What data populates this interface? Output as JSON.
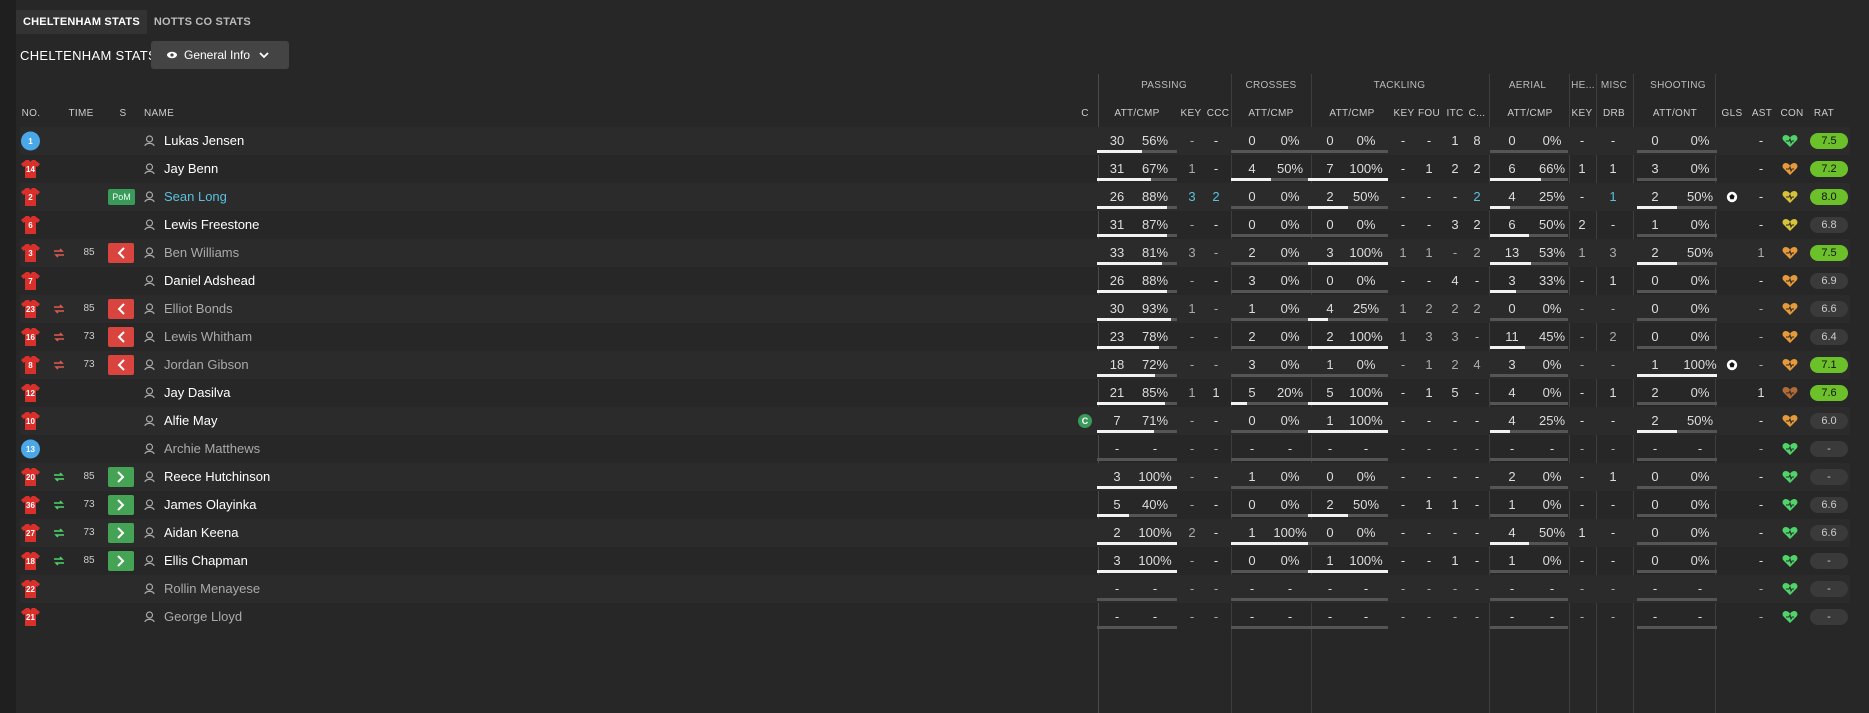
{
  "tabs": [
    {
      "label": "CHELTENHAM STATS",
      "active": true
    },
    {
      "label": "NOTTS CO STATS",
      "active": false
    }
  ],
  "section_title": "CHELTENHAM STATS",
  "view_dropdown": {
    "label": "General Info",
    "icon": "eye-icon"
  },
  "groups": [
    "PASSING",
    "CROSSES",
    "TACKLING",
    "AERIAL",
    "HE...",
    "MISC",
    "SHOOTING"
  ],
  "columns": {
    "no": "NO.",
    "time": "TIME",
    "s": "S",
    "name": "NAME",
    "c": "C",
    "pass_attcmp": "ATT/CMP",
    "pass_key": "KEY",
    "pass_ccc": "CCC",
    "cross_attcmp": "ATT/CMP",
    "tack_attcmp": "ATT/CMP",
    "tack_key": "KEY",
    "tack_fou": "FOU",
    "tack_itc": "ITC",
    "tack_c": "C...",
    "aer_attcmp": "ATT/CMP",
    "he_key": "KEY",
    "misc_drb": "DRB",
    "shoot_attont": "ATT/ONT",
    "gls": "GLS",
    "ast": "AST",
    "con": "CON",
    "rat": "RAT"
  },
  "colors": {
    "home_shirt": "#d9302c",
    "gk_shirt": "#4aa8e8",
    "rating_green": "#6cc02a",
    "highlight": "#5bc0de"
  },
  "players": [
    {
      "no": "1",
      "gk": true,
      "time": "",
      "sub": "",
      "pom": false,
      "name": "Lukas Jensen",
      "style": "",
      "capt": false,
      "pa": "30",
      "pp": "56%",
      "pbar": 56,
      "pk": "-",
      "pc": "-",
      "ca": "0",
      "cp": "0%",
      "cbar": 0,
      "ta": "0",
      "tp": "0%",
      "tbar": 0,
      "tk": "-",
      "tf": "-",
      "ti": "1",
      "tc": "8",
      "aa": "0",
      "ap": "0%",
      "abar": 0,
      "hk": "-",
      "md": "-",
      "sa": "0",
      "sp": "0%",
      "sbar": 0,
      "gls": "",
      "ast": "-",
      "rat": "7.5",
      "ratc": "green",
      "heart": "green"
    },
    {
      "no": "14",
      "gk": false,
      "time": "",
      "sub": "",
      "pom": false,
      "name": "Jay Benn",
      "style": "",
      "capt": false,
      "pa": "31",
      "pp": "67%",
      "pbar": 67,
      "pk": "1",
      "pc": "-",
      "ca": "4",
      "cp": "50%",
      "cbar": 50,
      "ta": "7",
      "tp": "100%",
      "tbar": 100,
      "tk": "-",
      "tf": "1",
      "ti": "2",
      "tc": "2",
      "aa": "6",
      "ap": "66%",
      "abar": 66,
      "hk": "1",
      "md": "1",
      "sa": "3",
      "sp": "0%",
      "sbar": 0,
      "gls": "",
      "ast": "-",
      "rat": "7.2",
      "ratc": "green",
      "heart": "orange"
    },
    {
      "no": "2",
      "gk": false,
      "time": "",
      "sub": "",
      "pom": true,
      "pom_label": "PoM",
      "name": "Sean Long",
      "style": "pom",
      "capt": false,
      "pa": "26",
      "pp": "88%",
      "pbar": 88,
      "pk": "3",
      "pc": "2",
      "hlk": true,
      "ca": "0",
      "cp": "0%",
      "cbar": 0,
      "ta": "2",
      "tp": "50%",
      "tbar": 50,
      "tk": "-",
      "tf": "-",
      "ti": "-",
      "tc": "2",
      "hltc": true,
      "aa": "4",
      "ap": "25%",
      "abar": 25,
      "hk": "-",
      "md": "1",
      "hlmd": true,
      "sa": "2",
      "sp": "50%",
      "sbar": 50,
      "gls": "ball",
      "ast": "-",
      "rat": "8.0",
      "ratc": "green",
      "heart": "yellow"
    },
    {
      "no": "6",
      "gk": false,
      "time": "",
      "sub": "",
      "pom": false,
      "name": "Lewis Freestone",
      "style": "",
      "capt": false,
      "pa": "31",
      "pp": "87%",
      "pbar": 87,
      "pk": "-",
      "pc": "-",
      "ca": "0",
      "cp": "0%",
      "cbar": 0,
      "ta": "0",
      "tp": "0%",
      "tbar": 0,
      "tk": "-",
      "tf": "-",
      "ti": "3",
      "tc": "2",
      "aa": "6",
      "ap": "50%",
      "abar": 50,
      "hk": "2",
      "md": "-",
      "sa": "1",
      "sp": "0%",
      "sbar": 0,
      "gls": "",
      "ast": "-",
      "rat": "6.8",
      "ratc": "grey",
      "heart": "yellow"
    },
    {
      "no": "3",
      "gk": false,
      "time": "85",
      "sub": "out",
      "pom": false,
      "name": "Ben Williams",
      "style": "sub",
      "capt": false,
      "pa": "33",
      "pp": "81%",
      "pbar": 81,
      "pk": "3",
      "pc": "-",
      "ca": "2",
      "cp": "0%",
      "cbar": 0,
      "ta": "3",
      "tp": "100%",
      "tbar": 100,
      "tk": "1",
      "tf": "1",
      "ti": "-",
      "tc": "2",
      "aa": "13",
      "ap": "53%",
      "abar": 53,
      "hk": "1",
      "md": "3",
      "sa": "2",
      "sp": "50%",
      "sbar": 50,
      "gls": "",
      "ast": "1",
      "rat": "7.5",
      "ratc": "green",
      "heart": "orange"
    },
    {
      "no": "7",
      "gk": false,
      "time": "",
      "sub": "",
      "pom": false,
      "name": "Daniel Adshead",
      "style": "",
      "capt": false,
      "pa": "26",
      "pp": "88%",
      "pbar": 88,
      "pk": "-",
      "pc": "-",
      "ca": "3",
      "cp": "0%",
      "cbar": 0,
      "ta": "0",
      "tp": "0%",
      "tbar": 0,
      "tk": "-",
      "tf": "-",
      "ti": "4",
      "tc": "-",
      "aa": "3",
      "ap": "33%",
      "abar": 33,
      "hk": "-",
      "md": "1",
      "sa": "0",
      "sp": "0%",
      "sbar": 0,
      "gls": "",
      "ast": "-",
      "rat": "6.9",
      "ratc": "grey",
      "heart": "orange"
    },
    {
      "no": "23",
      "gk": false,
      "time": "85",
      "sub": "out",
      "pom": false,
      "name": "Elliot Bonds",
      "style": "sub",
      "capt": false,
      "pa": "30",
      "pp": "93%",
      "pbar": 93,
      "pk": "1",
      "pc": "-",
      "ca": "1",
      "cp": "0%",
      "cbar": 0,
      "ta": "4",
      "tp": "25%",
      "tbar": 25,
      "tk": "1",
      "tf": "2",
      "ti": "2",
      "tc": "2",
      "aa": "0",
      "ap": "0%",
      "abar": 0,
      "hk": "-",
      "md": "-",
      "sa": "0",
      "sp": "0%",
      "sbar": 0,
      "gls": "",
      "ast": "-",
      "rat": "6.6",
      "ratc": "grey",
      "heart": "orange"
    },
    {
      "no": "16",
      "gk": false,
      "time": "73",
      "sub": "out",
      "pom": false,
      "name": "Lewis Whitham",
      "style": "sub",
      "capt": false,
      "pa": "23",
      "pp": "78%",
      "pbar": 78,
      "pk": "-",
      "pc": "-",
      "ca": "2",
      "cp": "0%",
      "cbar": 0,
      "ta": "2",
      "tp": "100%",
      "tbar": 100,
      "tk": "1",
      "tf": "3",
      "ti": "3",
      "tc": "-",
      "aa": "11",
      "ap": "45%",
      "abar": 45,
      "hk": "-",
      "md": "2",
      "sa": "0",
      "sp": "0%",
      "sbar": 0,
      "gls": "",
      "ast": "-",
      "rat": "6.4",
      "ratc": "grey",
      "heart": "orange"
    },
    {
      "no": "8",
      "gk": false,
      "time": "73",
      "sub": "out",
      "pom": false,
      "name": "Jordan Gibson",
      "style": "sub",
      "capt": false,
      "pa": "18",
      "pp": "72%",
      "pbar": 72,
      "pk": "-",
      "pc": "-",
      "ca": "3",
      "cp": "0%",
      "cbar": 0,
      "ta": "1",
      "tp": "0%",
      "tbar": 0,
      "tk": "-",
      "tf": "1",
      "ti": "2",
      "tc": "4",
      "aa": "3",
      "ap": "0%",
      "abar": 0,
      "hk": "-",
      "md": "-",
      "sa": "1",
      "sp": "100%",
      "sbar": 100,
      "gls": "ball",
      "ast": "-",
      "rat": "7.1",
      "ratc": "green",
      "heart": "orange"
    },
    {
      "no": "12",
      "gk": false,
      "time": "",
      "sub": "",
      "pom": false,
      "name": "Jay Dasilva",
      "style": "",
      "capt": false,
      "pa": "21",
      "pp": "85%",
      "pbar": 85,
      "pk": "1",
      "pc": "1",
      "ca": "5",
      "cp": "20%",
      "cbar": 20,
      "ta": "5",
      "tp": "100%",
      "tbar": 100,
      "tk": "-",
      "tf": "1",
      "ti": "5",
      "tc": "-",
      "aa": "4",
      "ap": "0%",
      "abar": 0,
      "hk": "-",
      "md": "1",
      "sa": "2",
      "sp": "0%",
      "sbar": 0,
      "gls": "",
      "ast": "1",
      "rat": "7.6",
      "ratc": "green",
      "heart": "brown"
    },
    {
      "no": "10",
      "gk": false,
      "time": "",
      "sub": "",
      "pom": false,
      "name": "Alfie May",
      "style": "",
      "capt": true,
      "capt_label": "C",
      "pa": "7",
      "pp": "71%",
      "pbar": 71,
      "pk": "-",
      "pc": "-",
      "ca": "0",
      "cp": "0%",
      "cbar": 0,
      "ta": "1",
      "tp": "100%",
      "tbar": 100,
      "tk": "-",
      "tf": "-",
      "ti": "-",
      "tc": "-",
      "aa": "4",
      "ap": "25%",
      "abar": 25,
      "hk": "-",
      "md": "-",
      "sa": "2",
      "sp": "50%",
      "sbar": 50,
      "gls": "",
      "ast": "-",
      "rat": "6.0",
      "ratc": "grey",
      "heart": "orange"
    },
    {
      "no": "13",
      "gk": true,
      "time": "",
      "sub": "",
      "pom": false,
      "name": "Archie Matthews",
      "style": "sub",
      "capt": false,
      "pa": "-",
      "pp": "-",
      "pbar": 0,
      "pk": "-",
      "pc": "-",
      "ca": "-",
      "cp": "-",
      "cbar": 0,
      "ta": "-",
      "tp": "-",
      "tbar": 0,
      "tk": "-",
      "tf": "-",
      "ti": "-",
      "tc": "-",
      "aa": "-",
      "ap": "-",
      "abar": 0,
      "hk": "-",
      "md": "-",
      "sa": "-",
      "sp": "-",
      "sbar": 0,
      "gls": "",
      "ast": "-",
      "rat": "-",
      "ratc": "grey",
      "heart": "green"
    },
    {
      "no": "20",
      "gk": false,
      "time": "85",
      "sub": "in",
      "pom": false,
      "name": "Reece Hutchinson",
      "style": "",
      "capt": false,
      "pa": "3",
      "pp": "100%",
      "pbar": 100,
      "pk": "-",
      "pc": "-",
      "ca": "1",
      "cp": "0%",
      "cbar": 0,
      "ta": "0",
      "tp": "0%",
      "tbar": 0,
      "tk": "-",
      "tf": "-",
      "ti": "-",
      "tc": "-",
      "aa": "2",
      "ap": "0%",
      "abar": 0,
      "hk": "-",
      "md": "1",
      "sa": "0",
      "sp": "0%",
      "sbar": 0,
      "gls": "",
      "ast": "-",
      "rat": "-",
      "ratc": "grey",
      "heart": "green"
    },
    {
      "no": "36",
      "gk": false,
      "time": "73",
      "sub": "in",
      "pom": false,
      "name": "James Olayinka",
      "style": "",
      "capt": false,
      "pa": "5",
      "pp": "40%",
      "pbar": 40,
      "pk": "-",
      "pc": "-",
      "ca": "0",
      "cp": "0%",
      "cbar": 0,
      "ta": "2",
      "tp": "50%",
      "tbar": 50,
      "tk": "-",
      "tf": "1",
      "ti": "1",
      "tc": "-",
      "aa": "1",
      "ap": "0%",
      "abar": 0,
      "hk": "-",
      "md": "-",
      "sa": "0",
      "sp": "0%",
      "sbar": 0,
      "gls": "",
      "ast": "-",
      "rat": "6.6",
      "ratc": "grey",
      "heart": "green"
    },
    {
      "no": "27",
      "gk": false,
      "time": "73",
      "sub": "in",
      "pom": false,
      "name": "Aidan Keena",
      "style": "",
      "capt": false,
      "pa": "2",
      "pp": "100%",
      "pbar": 100,
      "pk": "2",
      "pc": "-",
      "ca": "1",
      "cp": "100%",
      "cbar": 100,
      "ta": "0",
      "tp": "0%",
      "tbar": 0,
      "tk": "-",
      "tf": "-",
      "ti": "-",
      "tc": "-",
      "aa": "4",
      "ap": "50%",
      "abar": 50,
      "hk": "1",
      "md": "-",
      "sa": "0",
      "sp": "0%",
      "sbar": 0,
      "gls": "",
      "ast": "-",
      "rat": "6.6",
      "ratc": "grey",
      "heart": "green"
    },
    {
      "no": "18",
      "gk": false,
      "time": "85",
      "sub": "in",
      "pom": false,
      "name": "Ellis Chapman",
      "style": "",
      "capt": false,
      "pa": "3",
      "pp": "100%",
      "pbar": 100,
      "pk": "-",
      "pc": "-",
      "ca": "0",
      "cp": "0%",
      "cbar": 0,
      "ta": "1",
      "tp": "100%",
      "tbar": 100,
      "tk": "-",
      "tf": "-",
      "ti": "1",
      "tc": "-",
      "aa": "1",
      "ap": "0%",
      "abar": 0,
      "hk": "-",
      "md": "-",
      "sa": "0",
      "sp": "0%",
      "sbar": 0,
      "gls": "",
      "ast": "-",
      "rat": "-",
      "ratc": "grey",
      "heart": "green"
    },
    {
      "no": "22",
      "gk": false,
      "time": "",
      "sub": "",
      "pom": false,
      "name": "Rollin Menayese",
      "style": "sub",
      "capt": false,
      "pa": "-",
      "pp": "-",
      "pbar": 0,
      "pk": "-",
      "pc": "-",
      "ca": "-",
      "cp": "-",
      "cbar": 0,
      "ta": "-",
      "tp": "-",
      "tbar": 0,
      "tk": "-",
      "tf": "-",
      "ti": "-",
      "tc": "-",
      "aa": "-",
      "ap": "-",
      "abar": 0,
      "hk": "-",
      "md": "-",
      "sa": "-",
      "sp": "-",
      "sbar": 0,
      "gls": "",
      "ast": "-",
      "rat": "-",
      "ratc": "grey",
      "heart": "green"
    },
    {
      "no": "21",
      "gk": false,
      "time": "",
      "sub": "",
      "pom": false,
      "name": "George Lloyd",
      "style": "sub",
      "capt": false,
      "pa": "-",
      "pp": "-",
      "pbar": 0,
      "pk": "-",
      "pc": "-",
      "ca": "-",
      "cp": "-",
      "cbar": 0,
      "ta": "-",
      "tp": "-",
      "tbar": 0,
      "tk": "-",
      "tf": "-",
      "ti": "-",
      "tc": "-",
      "aa": "-",
      "ap": "-",
      "abar": 0,
      "hk": "-",
      "md": "-",
      "sa": "-",
      "sp": "-",
      "sbar": 0,
      "gls": "",
      "ast": "-",
      "rat": "-",
      "ratc": "grey",
      "heart": "green"
    }
  ]
}
